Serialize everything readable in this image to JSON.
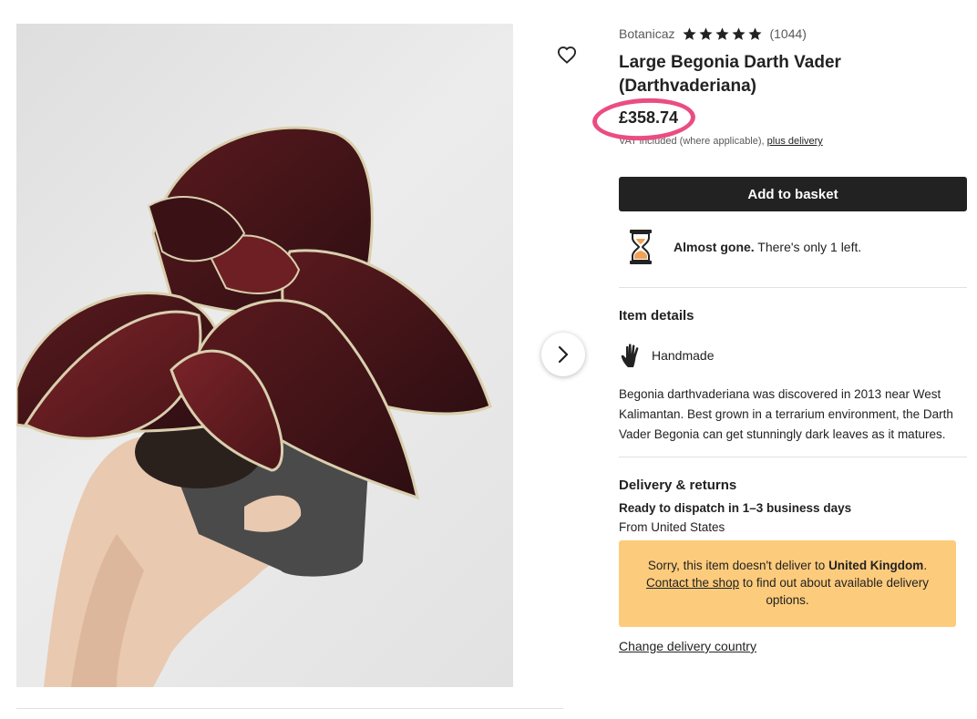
{
  "product": {
    "shop_name": "Botanicaz",
    "rating": 5,
    "review_count": "(1044)",
    "title": "Large Begonia Darth Vader (Darthvaderiana)",
    "price": "£358.74",
    "vat_note": "VAT included (where applicable),",
    "delivery_link": "plus delivery"
  },
  "actions": {
    "add_to_basket": "Add to basket",
    "favorite_icon": "heart-icon",
    "next_image_icon": "chevron-right-icon"
  },
  "stock": {
    "icon": "hourglass-icon",
    "label_bold": "Almost gone.",
    "label_rest": " There's only 1 left."
  },
  "item_details": {
    "title": "Item details",
    "handmade_icon": "hand-icon",
    "handmade_label": "Handmade",
    "description": "Begonia darthvaderiana was discovered in 2013 near West Kalimantan. Best grown in a terrarium environment, the Darth Vader Begonia can get stunningly dark leaves as it matures."
  },
  "delivery": {
    "title": "Delivery & returns",
    "dispatch": "Ready to dispatch in 1–3 business days",
    "from": "From United States",
    "notice_text_1": "Sorry, this item doesn't deliver to ",
    "notice_country": "United Kingdom",
    "notice_text_2": ". ",
    "notice_link": "Contact the shop",
    "notice_text_3": " to find out about available delivery options.",
    "change_country": "Change delivery country"
  },
  "colors": {
    "price_highlight": "#ea4d82",
    "notice_bg": "#fdcb7c",
    "button_bg": "#222222",
    "hourglass_sand": "#f1a256"
  }
}
